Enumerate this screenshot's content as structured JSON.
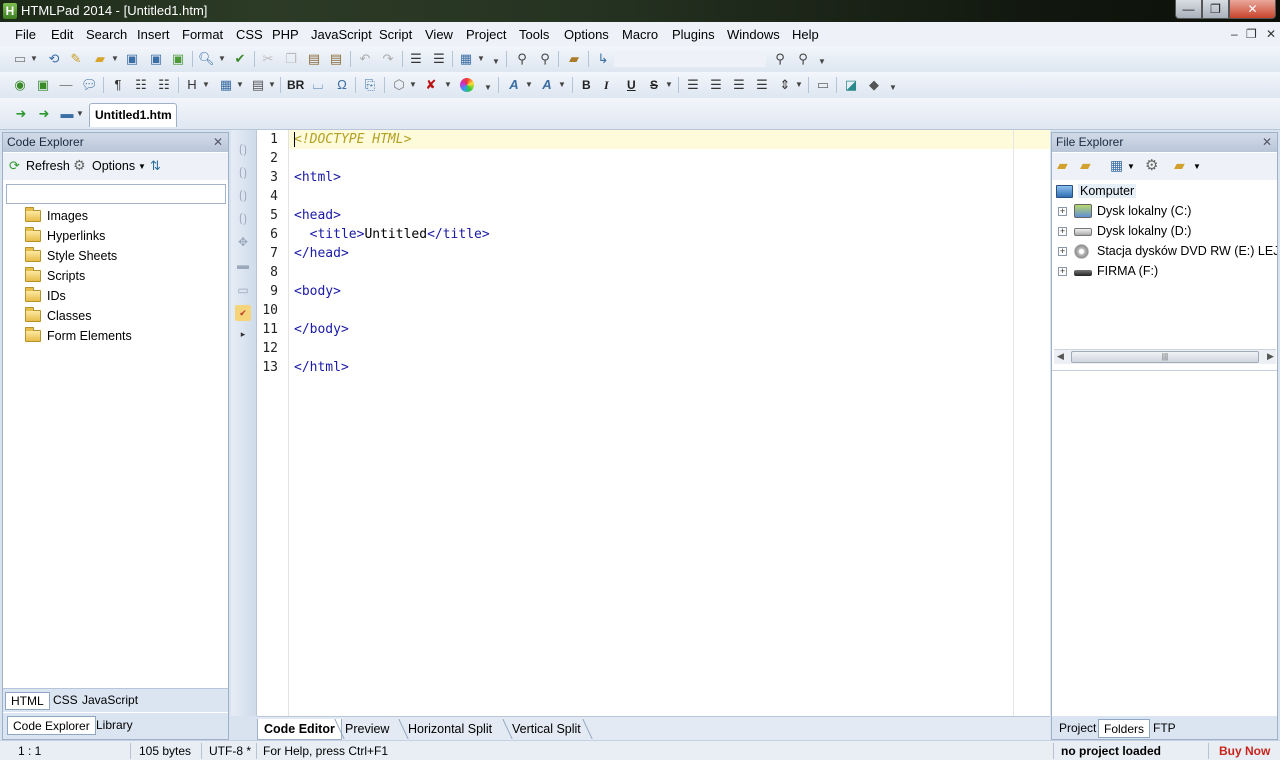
{
  "window": {
    "title": "HTMLPad 2014 - [Untitled1.htm]",
    "app_icon_letter": "H",
    "minimize": "—",
    "maximize": "❐",
    "close": "✕"
  },
  "menu": [
    "File",
    "Edit",
    "Search",
    "Insert",
    "Format",
    "CSS",
    "PHP",
    "JavaScript",
    "Script",
    "View",
    "Project",
    "Tools",
    "Options",
    "Macro",
    "Plugins",
    "Windows",
    "Help"
  ],
  "mdi_controls": [
    "–",
    "❐",
    "✕"
  ],
  "toolbar2": {
    "br_label": "BR",
    "bold": "B",
    "italic": "I",
    "underline": "U",
    "strike": "S"
  },
  "document_tab": "Untitled1.htm",
  "code_explorer": {
    "title": "Code Explorer",
    "refresh": "Refresh",
    "options": "Options",
    "items": [
      "Images",
      "Hyperlinks",
      "Style Sheets",
      "Scripts",
      "IDs",
      "Classes",
      "Form Elements"
    ],
    "lang_tabs": [
      "HTML",
      "CSS",
      "JavaScript"
    ],
    "panel_tabs": [
      "Code Explorer",
      "Library"
    ]
  },
  "editor": {
    "line_numbers": [
      "1",
      "2",
      "3",
      "4",
      "5",
      "6",
      "7",
      "8",
      "9",
      "10",
      "11",
      "12",
      "13"
    ],
    "lines": {
      "l1": "<!DOCTYPE HTML>",
      "l3": "<html>",
      "l5": "<head>",
      "l6_open": "  <title>",
      "l6_text": "Untitled",
      "l6_close": "</title>",
      "l7": "</head>",
      "l9": "<body>",
      "l11": "</body>",
      "l13": "</html>"
    },
    "view_tabs": [
      "Code Editor",
      "Preview",
      "Horizontal Split",
      "Vertical Split"
    ]
  },
  "file_explorer": {
    "title": "File Explorer",
    "root": "Komputer",
    "drives": [
      "Dysk lokalny (C:)",
      "Dysk lokalny (D:)",
      "Stacja dysków DVD RW (E:) LEJDIS",
      "FIRMA (F:)"
    ],
    "tabs": [
      "Project",
      "Folders",
      "FTP"
    ]
  },
  "status": {
    "position": "1 : 1",
    "size": "105 bytes",
    "encoding": "UTF-8 *",
    "help": "For Help, press Ctrl+F1",
    "project": "no project loaded",
    "buy": "Buy Now"
  }
}
